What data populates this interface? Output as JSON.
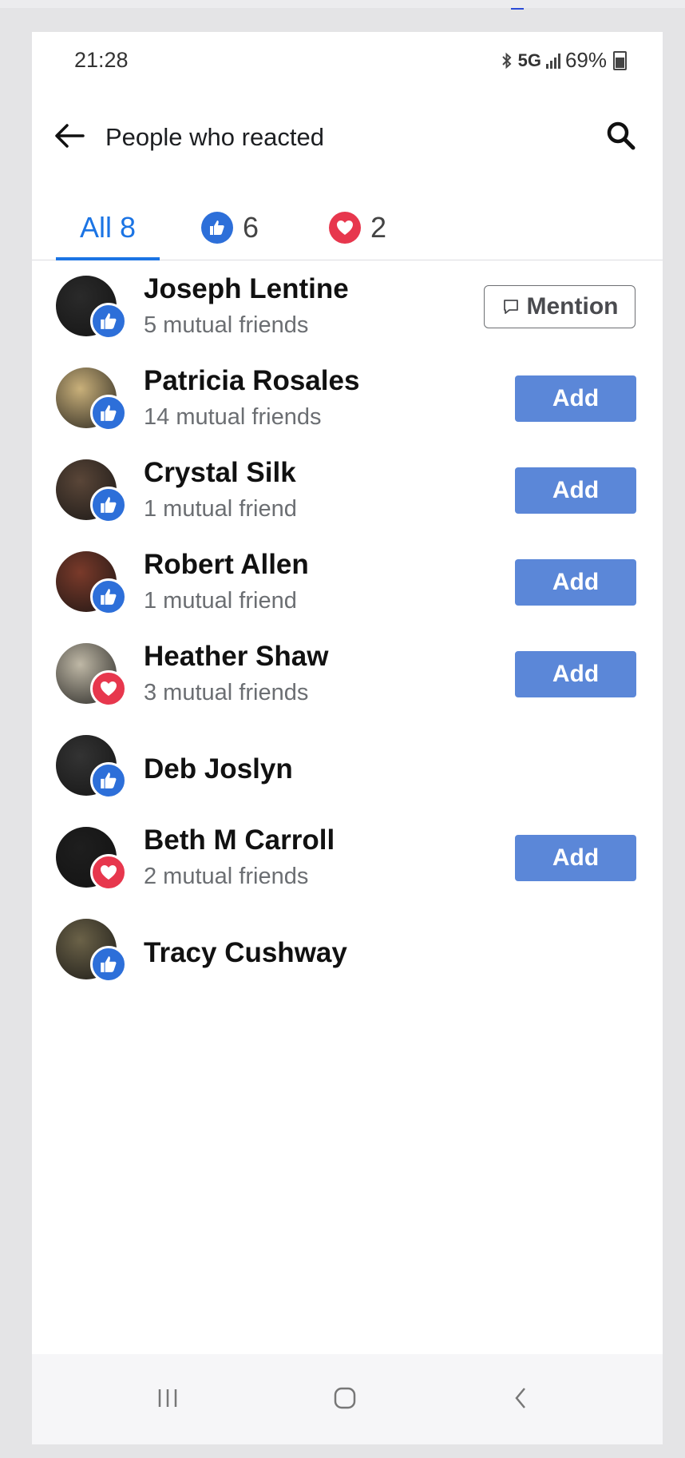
{
  "status_bar": {
    "time": "21:28",
    "network": "5G",
    "battery": "69%"
  },
  "header": {
    "title": "People who reacted"
  },
  "tabs": [
    {
      "label": "All 8",
      "kind": "all"
    },
    {
      "label": "6",
      "kind": "like"
    },
    {
      "label": "2",
      "kind": "love"
    }
  ],
  "people": [
    {
      "name": "Joseph Lentine",
      "mutual": "5 mutual friends",
      "reaction": "like",
      "action": "Mention",
      "avatar_color": "#2a2a2a"
    },
    {
      "name": "Patricia Rosales",
      "mutual": "14 mutual friends",
      "reaction": "like",
      "action": "Add",
      "avatar_color": "#c9b07a"
    },
    {
      "name": "Crystal Silk",
      "mutual": "1 mutual friend",
      "reaction": "like",
      "action": "Add",
      "avatar_color": "#5a4638"
    },
    {
      "name": "Robert Allen",
      "mutual": "1 mutual friend",
      "reaction": "like",
      "action": "Add",
      "avatar_color": "#7a3a2a"
    },
    {
      "name": "Heather Shaw",
      "mutual": "3 mutual friends",
      "reaction": "love",
      "action": "Add",
      "avatar_color": "#bfb8a6"
    },
    {
      "name": "Deb Joslyn",
      "mutual": "",
      "reaction": "like",
      "action": "",
      "avatar_color": "#333333"
    },
    {
      "name": "Beth M Carroll",
      "mutual": "2 mutual friends",
      "reaction": "love",
      "action": "Add",
      "avatar_color": "#1e1e1e"
    },
    {
      "name": "Tracy Cushway",
      "mutual": "",
      "reaction": "like",
      "action": "",
      "avatar_color": "#6b6248"
    }
  ],
  "colors": {
    "accent": "#1b74e4",
    "like": "#2d6fd9",
    "love": "#e7374d",
    "add_button": "#5b87d8"
  },
  "icons": {
    "back": "arrow-left-icon",
    "search": "search-icon",
    "like": "thumbs-up-icon",
    "love": "heart-icon",
    "mention": "speech-bubble-icon",
    "nav_recents": "recents-icon",
    "nav_home": "home-icon",
    "nav_back": "chevron-left-icon"
  }
}
